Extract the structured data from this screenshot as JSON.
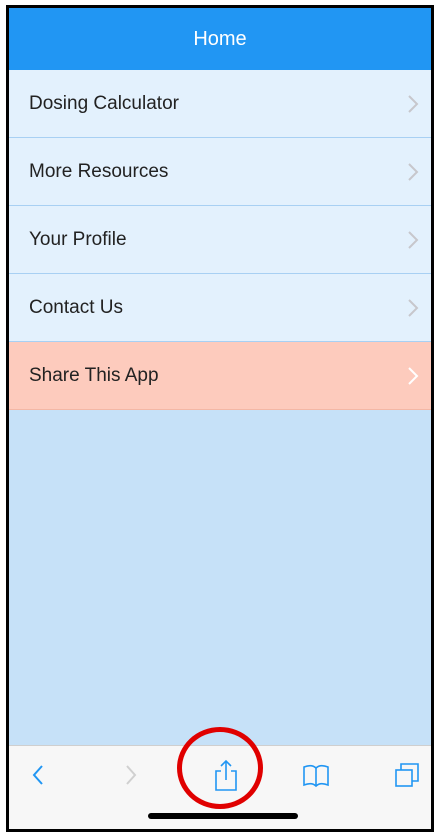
{
  "header": {
    "title": "Home"
  },
  "menu": {
    "items": [
      {
        "label": "Dosing Calculator"
      },
      {
        "label": "More Resources"
      },
      {
        "label": "Your Profile"
      },
      {
        "label": "Contact Us"
      },
      {
        "label": "Share This App"
      }
    ]
  },
  "toolbar": {
    "icons": [
      "back-icon",
      "forward-icon",
      "share-icon",
      "bookmarks-icon",
      "tabs-icon"
    ]
  },
  "colors": {
    "header_bg": "#2196f3",
    "menu_bg": "#e3f1fd",
    "share_bg": "#fdcbbd",
    "content_bg": "#c6e1f8",
    "toolbar_icon": "#2196f3",
    "annotation": "#e00000"
  }
}
